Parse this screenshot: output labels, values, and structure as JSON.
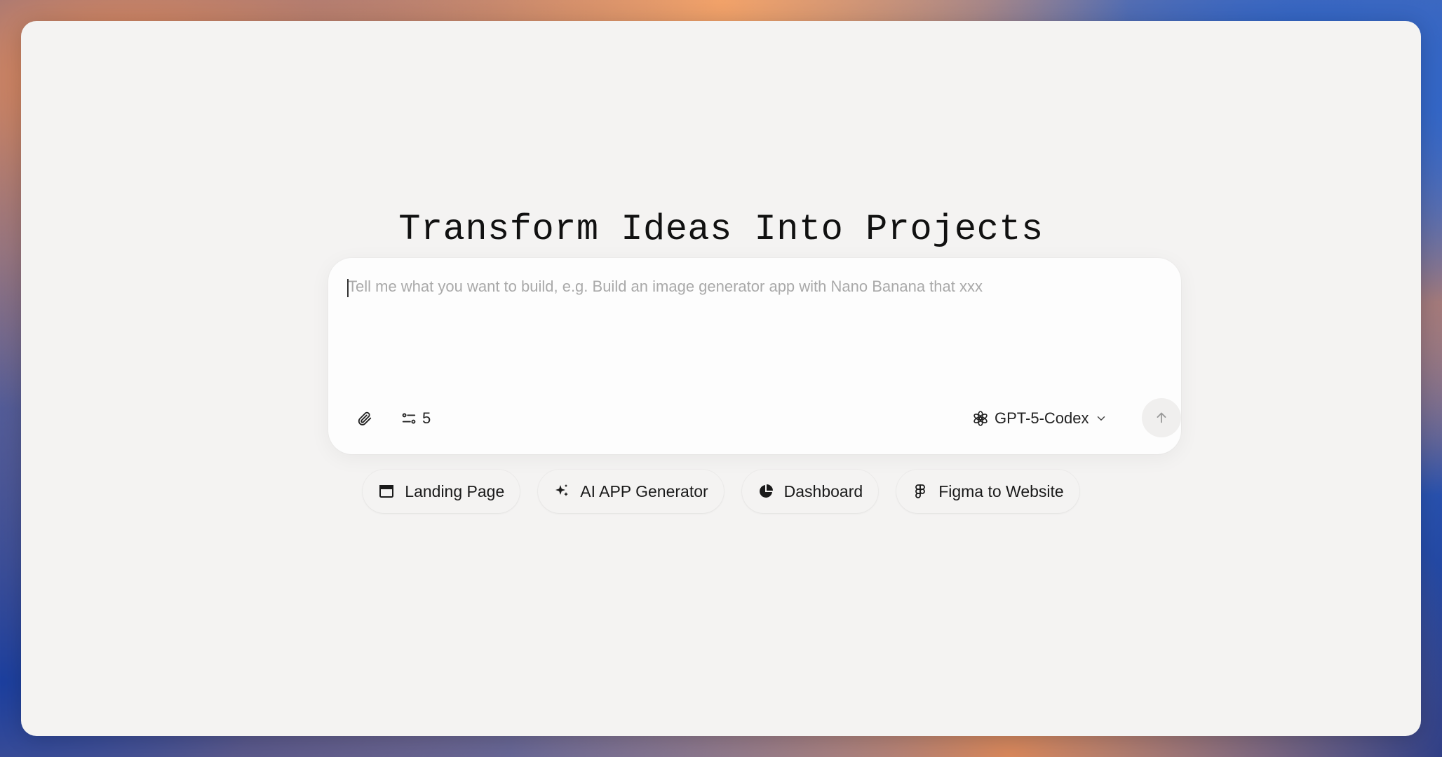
{
  "page": {
    "title": "Transform Ideas Into Projects"
  },
  "composer": {
    "placeholder": "Tell me what you want to build, e.g. Build an image generator app with Nano Banana that xxx",
    "value": "",
    "attach_icon": "paperclip-icon",
    "steps_icon": "sliders-icon",
    "steps_count": "5",
    "model_icon": "openai-logo-icon",
    "model_label": "GPT-5-Codex",
    "model_dropdown_icon": "chevron-down-icon",
    "send_icon": "arrow-up-icon"
  },
  "suggestions": [
    {
      "label": "Landing Page",
      "icon": "browser-window-icon"
    },
    {
      "label": "AI APP Generator",
      "icon": "sparkles-icon"
    },
    {
      "label": "Dashboard",
      "icon": "pie-chart-icon"
    },
    {
      "label": "Figma to Website",
      "icon": "figma-icon"
    }
  ],
  "colors": {
    "window_bg": "#f4f3f2",
    "composer_bg": "#fdfdfd",
    "placeholder": "#a9a9a9",
    "text": "#1a1a1a",
    "send_bg": "#f0efee"
  }
}
